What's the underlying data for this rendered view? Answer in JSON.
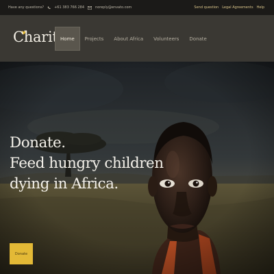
{
  "topbar": {
    "question": "Have any questions?",
    "phone": "+61 383 766 284",
    "email": "noreply@envato.com",
    "links": [
      "Send question",
      "Legal Agreements",
      "Help"
    ]
  },
  "header": {
    "logo": "Charity",
    "nav": [
      {
        "label": "Home",
        "active": true
      },
      {
        "label": "Projects",
        "active": false
      },
      {
        "label": "About Africa",
        "active": false
      },
      {
        "label": "Volunteers",
        "active": false
      },
      {
        "label": "Donate",
        "active": false
      }
    ]
  },
  "hero": {
    "lines": [
      "Donate.",
      "Feed hungry children",
      "dying in Africa."
    ],
    "button_label": "Donate"
  },
  "colors": {
    "accent": "#e3b936",
    "header_bg": "#3a3833",
    "topbar_bg": "#1b1a18"
  },
  "icons": [
    "phone-icon",
    "mail-icon",
    "heart-icon"
  ]
}
